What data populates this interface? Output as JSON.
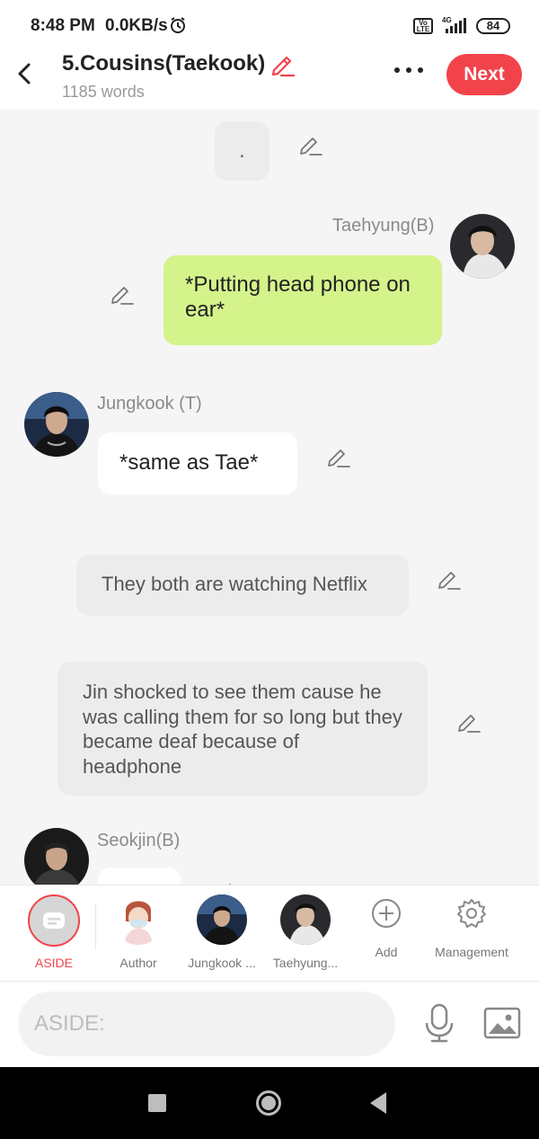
{
  "status_bar": {
    "time": "8:48 PM",
    "network_speed": "0.0KB/s",
    "volte": "Vo LTE",
    "signal_type": "4G",
    "battery": "84"
  },
  "header": {
    "title": "5.Cousins(Taekook)",
    "word_count": "1185 words",
    "next_label": "Next"
  },
  "chat": {
    "top_bubble_text": ".",
    "msg1": {
      "speaker": "Taehyung(B)",
      "text": "*Putting head phone on ear*"
    },
    "msg2": {
      "speaker": "Jungkook (T)",
      "text": "*same as Tae*"
    },
    "narration1": "They both are watching Netflix",
    "narration2": "Jin shocked to see them cause he was calling them for so long but they became deaf because of headphone",
    "msg3": {
      "speaker": "Seokjin(B)"
    }
  },
  "char_bar": {
    "items": [
      {
        "label": "ASIDE"
      },
      {
        "label": "Author"
      },
      {
        "label": "Jungkook ..."
      },
      {
        "label": "Taehyung..."
      },
      {
        "label": "Add"
      },
      {
        "label": "Management"
      }
    ]
  },
  "input": {
    "placeholder": "ASIDE:"
  },
  "colors": {
    "accent": "#f2434a",
    "own_bubble": "#d4f38b",
    "chat_bg": "#f5f5f5"
  }
}
